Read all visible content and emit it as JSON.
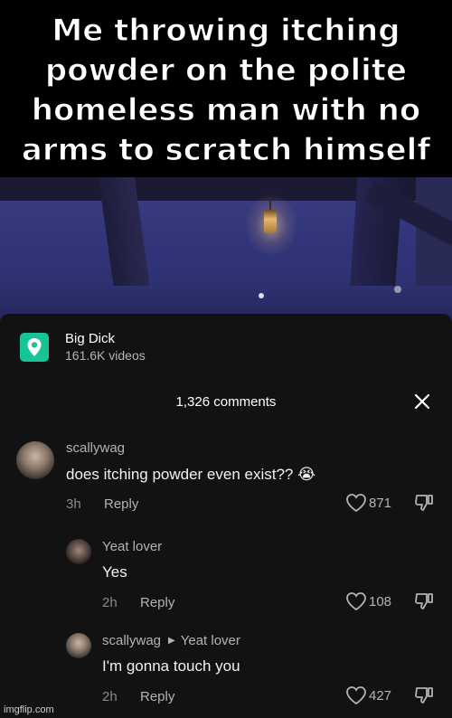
{
  "meme": {
    "caption": "Me throwing itching powder on the polite homeless man with no arms to scratch himself"
  },
  "place": {
    "name": "Big Dick",
    "subtitle": "161.6K videos",
    "icon": "location-pin-icon",
    "accent_color": "#17c496"
  },
  "comments_panel": {
    "title": "1,326 comments",
    "close_icon": "close-icon"
  },
  "comments": [
    {
      "username": "scallywag",
      "text": "does itching powder even exist?? 😭",
      "time": "3h",
      "reply_label": "Reply",
      "likes": "871"
    },
    {
      "username": "Yeat lover",
      "text": "Yes",
      "time": "2h",
      "reply_label": "Reply",
      "likes": "108"
    },
    {
      "username": "scallywag",
      "reply_to": "Yeat lover",
      "text": "I'm gonna touch you",
      "time": "2h",
      "reply_label": "Reply",
      "likes": "427"
    }
  ],
  "watermark": "imgflip.com"
}
